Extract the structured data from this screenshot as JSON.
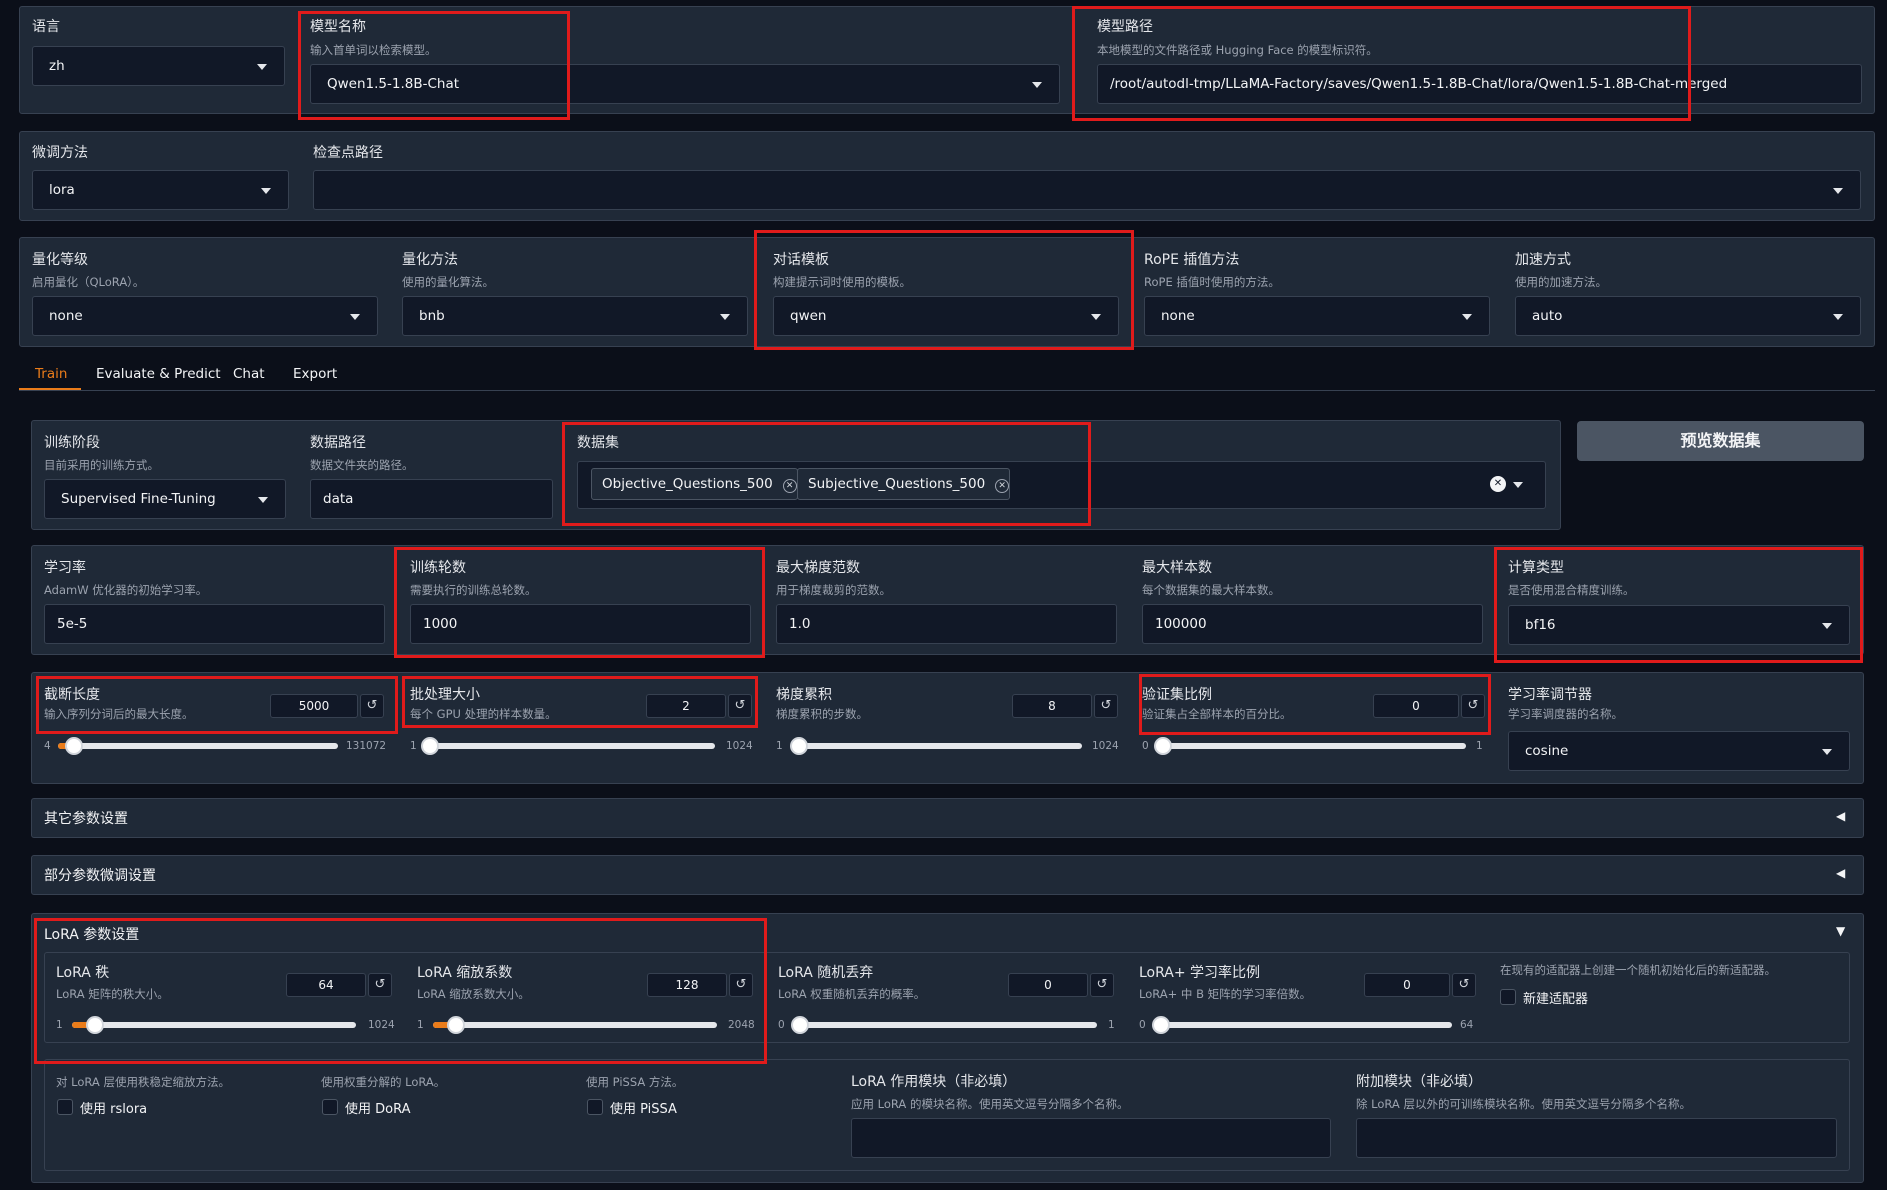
{
  "top": {
    "lang": {
      "label": "语言",
      "value": "zh"
    },
    "model_name": {
      "label": "模型名称",
      "info": "输入首单词以检索模型。",
      "value": "Qwen1.5-1.8B-Chat"
    },
    "model_path": {
      "label": "模型路径",
      "info": "本地模型的文件路径或 Hugging Face 的模型标识符。",
      "value": "/root/autodl-tmp/LLaMA-Factory/saves/Qwen1.5-1.8B-Chat/lora/Qwen1.5-1.8B-Chat-merged"
    }
  },
  "row2": {
    "finetune": {
      "label": "微调方法",
      "value": "lora"
    },
    "checkpoint": {
      "label": "检查点路径",
      "value": ""
    }
  },
  "row3": {
    "quant_bit": {
      "label": "量化等级",
      "info": "启用量化（QLoRA）。",
      "value": "none"
    },
    "quant_method": {
      "label": "量化方法",
      "info": "使用的量化算法。",
      "value": "bnb"
    },
    "template": {
      "label": "对话模板",
      "info": "构建提示词时使用的模板。",
      "value": "qwen"
    },
    "rope": {
      "label": "RoPE 插值方法",
      "info": "RoPE 插值时使用的方法。",
      "value": "none"
    },
    "booster": {
      "label": "加速方式",
      "info": "使用的加速方法。",
      "value": "auto"
    }
  },
  "tabs": [
    "Train",
    "Evaluate & Predict",
    "Chat",
    "Export"
  ],
  "train": {
    "stage": {
      "label": "训练阶段",
      "info": "目前采用的训练方式。",
      "value": "Supervised Fine-Tuning"
    },
    "dataset_dir": {
      "label": "数据路径",
      "info": "数据文件夹的路径。",
      "value": "data"
    },
    "dataset": {
      "label": "数据集",
      "chips": [
        "Objective_Questions_500",
        "Subjective_Questions_500"
      ]
    },
    "preview_button": "预览数据集",
    "lr": {
      "label": "学习率",
      "info": "AdamW 优化器的初始学习率。",
      "value": "5e-5"
    },
    "epochs": {
      "label": "训练轮数",
      "info": "需要执行的训练总轮数。",
      "value": "1000"
    },
    "max_grad_norm": {
      "label": "最大梯度范数",
      "info": "用于梯度裁剪的范数。",
      "value": "1.0"
    },
    "max_samples": {
      "label": "最大样本数",
      "info": "每个数据集的最大样本数。",
      "value": "100000"
    },
    "compute_type": {
      "label": "计算类型",
      "info": "是否使用混合精度训练。",
      "value": "bf16"
    },
    "cutoff_len": {
      "label": "截断长度",
      "info": "输入序列分词后的最大长度。",
      "value": "5000",
      "min": "4",
      "max": "131072",
      "fraction": 0.038
    },
    "batch_size": {
      "label": "批处理大小",
      "info": "每个 GPU 处理的样本数量。",
      "value": "2",
      "min": "1",
      "max": "1024",
      "fraction": 0.001
    },
    "grad_accum": {
      "label": "梯度累积",
      "info": "梯度累积的步数。",
      "value": "8",
      "min": "1",
      "max": "1024",
      "fraction": 0.007
    },
    "val_size": {
      "label": "验证集比例",
      "info": "验证集占全部样本的百分比。",
      "value": "0",
      "min": "0",
      "max": "1",
      "fraction": 0
    },
    "lr_scheduler": {
      "label": "学习率调节器",
      "info": "学习率调度器的名称。",
      "value": "cosine"
    },
    "other_settings": "其它参数设置",
    "freeze_settings": "部分参数微调设置",
    "lora": {
      "title": "LoRA 参数设置",
      "rank": {
        "label": "LoRA 秩",
        "info": "LoRA 矩阵的秩大小。",
        "value": "64",
        "min": "1",
        "max": "1024",
        "fraction": 0.062
      },
      "alpha": {
        "label": "LoRA 缩放系数",
        "info": "LoRA 缩放系数大小。",
        "value": "128",
        "min": "1",
        "max": "2048",
        "fraction": 0.062
      },
      "dropout": {
        "label": "LoRA 随机丢弃",
        "info": "LoRA 权重随机丢弃的概率。",
        "value": "0",
        "min": "0",
        "max": "1",
        "fraction": 0
      },
      "plus_ratio": {
        "label": "LoRA+ 学习率比例",
        "info": "LoRA+ 中 B 矩阵的学习率倍数。",
        "value": "0",
        "min": "0",
        "max": "64",
        "fraction": 0
      },
      "new_adapter": {
        "info": "在现有的适配器上创建一个随机初始化后的新适配器。",
        "label": "新建适配器"
      },
      "rslora": {
        "info": "对 LoRA 层使用秩稳定缩放方法。",
        "label": "使用 rslora"
      },
      "dora": {
        "info": "使用权重分解的 LoRA。",
        "label": "使用 DoRA"
      },
      "pissa": {
        "info": "使用 PiSSA 方法。",
        "label": "使用 PiSSA"
      },
      "target": {
        "label": "LoRA 作用模块（非必填）",
        "info": "应用 LoRA 的模块名称。使用英文逗号分隔多个名称。"
      },
      "additional": {
        "label": "附加模块（非必填）",
        "info": "除 LoRA 层以外的可训练模块名称。使用英文逗号分隔多个名称。"
      }
    }
  },
  "colors": {
    "accent": "#ea7c1a",
    "highlight_box": "#e01b1b",
    "background": "#0b0f19",
    "panel": "#1f2937"
  },
  "icons": [
    "chevron-down-icon",
    "reset-icon",
    "close-icon",
    "collapse-arrow-icon"
  ]
}
